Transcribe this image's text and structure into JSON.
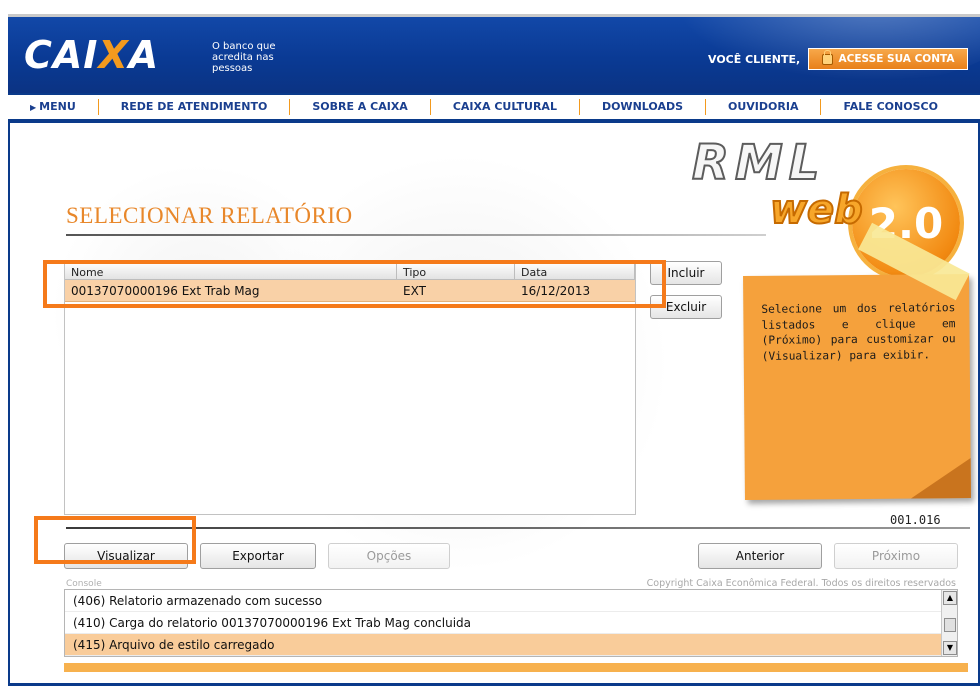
{
  "header": {
    "logo_text_a": "CAI",
    "logo_text_x": "X",
    "logo_text_b": "A",
    "tagline": "O banco que acredita nas pessoas",
    "voce_cliente": "VOCÊ CLIENTE,",
    "acesse_label": "ACESSE SUA CONTA"
  },
  "nav": {
    "items": [
      "MENU",
      "REDE DE ATENDIMENTO",
      "SOBRE A CAIXA",
      "CAIXA CULTURAL",
      "DOWNLOADS",
      "OUVIDORIA",
      "FALE CONOSCO"
    ]
  },
  "brand": {
    "rml": "RML",
    "web": "web",
    "version": "2.0"
  },
  "page": {
    "title": "SELECIONAR RELATÓRIO"
  },
  "table": {
    "headers": [
      "Nome",
      "Tipo",
      "Data"
    ],
    "rows": [
      {
        "nome": "00137070000196 Ext Trab Mag",
        "tipo": "EXT",
        "data": "16/12/2013"
      }
    ]
  },
  "buttons": {
    "incluir": "Incluir",
    "excluir": "Excluir",
    "visualizar": "Visualizar",
    "exportar": "Exportar",
    "opcoes": "Opções",
    "anterior": "Anterior",
    "proximo": "Próximo"
  },
  "note": {
    "text": "Selecione um dos relatórios listados e clique em (Próximo) para customizar ou (Visualizar) para exibir."
  },
  "step_code": "001.016",
  "console": {
    "label": "Console",
    "copyright": "Copyright Caixa Econômica Federal. Todos os direitos reservados",
    "lines": [
      "(406) Relatorio armazenado com sucesso",
      "(410) Carga do relatorio 00137070000196 Ext Trab Mag concluida",
      "(415) Arquivo de estilo carregado"
    ]
  },
  "colors": {
    "header_blue": "#0a3a8a",
    "accent_orange": "#f39a1e",
    "highlight_orange": "#f57a1a",
    "row_selected": "#f9d1a7"
  }
}
